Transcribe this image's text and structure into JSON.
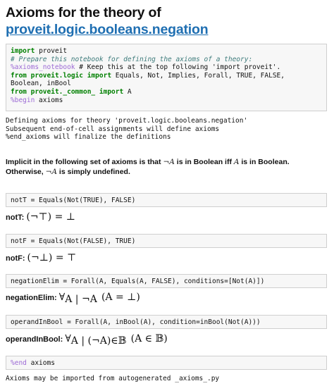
{
  "title": {
    "prefix": "Axioms for the theory of",
    "link": "proveit.logic.booleans.negation"
  },
  "cell1": {
    "lines": [
      "import proveit",
      "# Prepare this notebook for defining the axioms of a theory:",
      "%axioms_notebook # Keep this at the top following 'import proveit'.",
      "from proveit.logic import Equals, Not, Implies, Forall, TRUE, FALSE,",
      "Boolean, inBool",
      "from proveit._common_ import A",
      "%begin axioms"
    ]
  },
  "output1": {
    "lines": [
      "Defining axioms for theory 'proveit.logic.booleans.negation'",
      "Subsequent end-of-cell assignments will define axioms",
      "%end_axioms will finalize the definitions"
    ]
  },
  "markdown": {
    "line1_a": "Implicit in the following set of axioms is that ",
    "line1_math_neg": "¬",
    "line1_math_A": "A",
    "line1_b": " is in Boolean iff ",
    "line1_math_A2": "A",
    "line1_c": " is in Boolean.",
    "line2_a": "Otherwise, ",
    "line2_math_neg": "¬",
    "line2_math_A": "A",
    "line2_b": " is simply undefined."
  },
  "axioms": [
    {
      "code": "notT = Equals(Not(TRUE), FALSE)",
      "label": "notT:",
      "math": "(¬⊤) = ⊥"
    },
    {
      "code": "notF = Equals(Not(FALSE), TRUE)",
      "label": "notF:",
      "math": "(¬⊥) = ⊤"
    },
    {
      "code": "negationElim = Forall(A, Equals(A, FALSE), conditions=[Not(A)])",
      "label": "negationElim:",
      "math_forall": "∀",
      "math_sub": "A | ¬A",
      "math_body": "(A = ⊥)"
    },
    {
      "code": "operandInBool = Forall(A, inBool(A), condition=inBool(Not(A)))",
      "label": "operandInBool:",
      "math_forall": "∀",
      "math_sub": "A | (¬A)∈𝔹",
      "math_body": "(A ∈ 𝔹)"
    }
  ],
  "cell_end": {
    "magic": "%end",
    "rest": " axioms"
  },
  "output_end": {
    "line": "Axioms may be imported from autogenerated _axioms_.py"
  },
  "colors": {
    "link": "#1f6fb2",
    "keyword": "#008000",
    "comment": "#3d7b7b",
    "magic": "#9c6ad5",
    "cell_bg": "#f7f7f7",
    "cell_border": "#cfcfcf"
  }
}
